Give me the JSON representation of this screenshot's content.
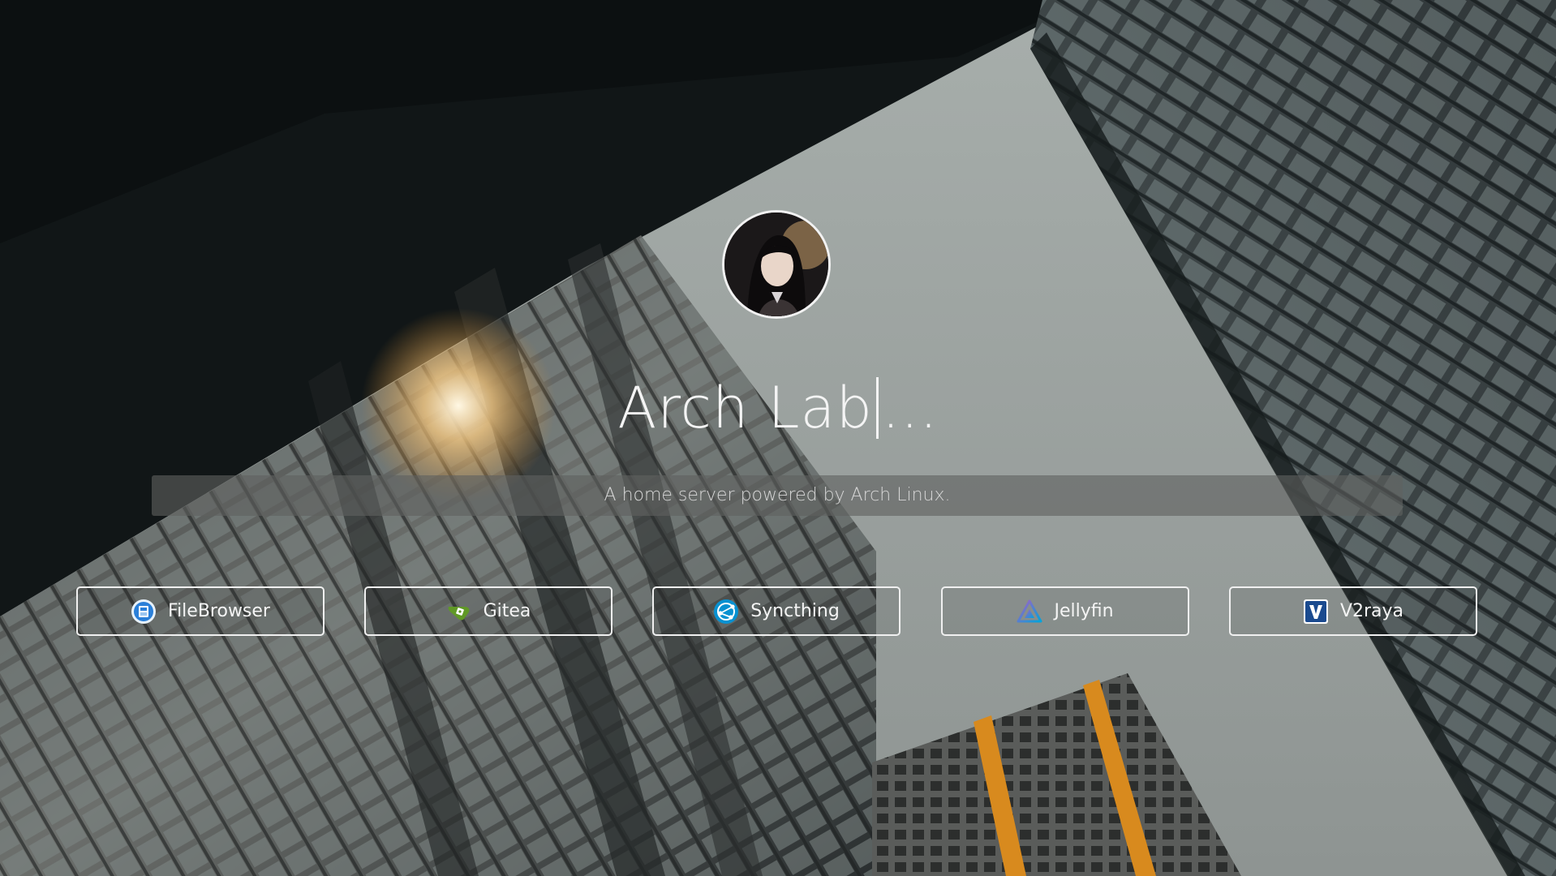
{
  "hero": {
    "title": "Arch Lab",
    "title_suffix": "...",
    "subtitle": "A home server powered by Arch Linux."
  },
  "links": [
    {
      "label": "FileBrowser",
      "icon": "filebrowser-icon",
      "color": "#2a7fd8"
    },
    {
      "label": "Gitea",
      "icon": "gitea-icon",
      "color": "#609926"
    },
    {
      "label": "Syncthing",
      "icon": "syncthing-icon",
      "color": "#0891d1"
    },
    {
      "label": "Jellyfin",
      "icon": "jellyfin-icon",
      "color": "#aa5cc3"
    },
    {
      "label": "V2raya",
      "icon": "v2raya-icon",
      "color": "#1a4a8f"
    }
  ]
}
